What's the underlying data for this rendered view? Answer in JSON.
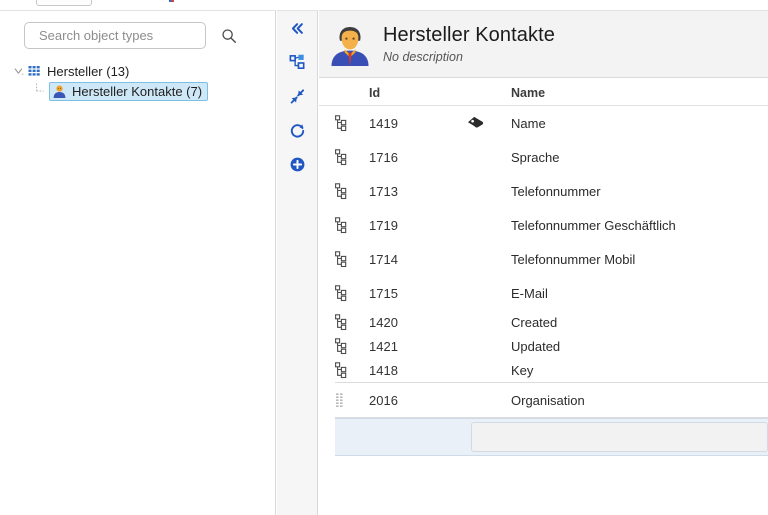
{
  "sidebar": {
    "search": {
      "placeholder": "Search object types",
      "value": "",
      "icon": "search-icon"
    },
    "tree": [
      {
        "label": "Hersteller (13)",
        "icon": "grid-table-icon",
        "level": 0,
        "selected": false,
        "expanded": true
      },
      {
        "label": "Hersteller Kontakte (7)",
        "icon": "person-icon",
        "level": 1,
        "selected": true,
        "expanded": false
      }
    ]
  },
  "toolbar": {
    "buttons": [
      {
        "name": "collapse-panel-button",
        "icon": "double-chevron-left-icon",
        "label": "«"
      },
      {
        "name": "hierarchy-view-button",
        "icon": "hierarchy-icon",
        "label": ""
      },
      {
        "name": "collapse-all-button",
        "icon": "collapse-arrows-icon",
        "label": ""
      },
      {
        "name": "refresh-button",
        "icon": "refresh-icon",
        "label": ""
      },
      {
        "name": "add-button",
        "icon": "plus-circle-icon",
        "label": ""
      }
    ]
  },
  "main": {
    "header": {
      "icon": "person-avatar-icon",
      "title": "Hersteller Kontakte",
      "description": "No description"
    },
    "table": {
      "columns": [
        {
          "key": "icon",
          "label": ""
        },
        {
          "key": "id",
          "label": "Id"
        },
        {
          "key": "tag",
          "label": ""
        },
        {
          "key": "name",
          "label": "Name"
        }
      ],
      "rows": [
        {
          "icon": "attribute-hierarchy-icon",
          "id": "1419",
          "tag": "tag-icon",
          "name": "Name"
        },
        {
          "icon": "attribute-hierarchy-icon",
          "id": "1716",
          "tag": "",
          "name": "Sprache"
        },
        {
          "icon": "attribute-hierarchy-icon",
          "id": "1713",
          "tag": "",
          "name": "Telefonnummer"
        },
        {
          "icon": "attribute-hierarchy-icon",
          "id": "1719",
          "tag": "",
          "name": "Telefonnummer Geschäftlich"
        },
        {
          "icon": "attribute-hierarchy-icon",
          "id": "1714",
          "tag": "",
          "name": "Telefonnummer Mobil"
        },
        {
          "icon": "attribute-hierarchy-icon",
          "id": "1715",
          "tag": "",
          "name": "E-Mail"
        },
        {
          "icon": "attribute-hierarchy-icon",
          "id": "1420",
          "tag": "",
          "name": "Created"
        },
        {
          "icon": "attribute-hierarchy-icon",
          "id": "1421",
          "tag": "",
          "name": "Updated"
        },
        {
          "icon": "attribute-hierarchy-icon",
          "id": "1418",
          "tag": "",
          "name": "Key"
        }
      ],
      "inherited_rows": [
        {
          "icon": "dotted-grid-icon",
          "id": "2016",
          "tag": "",
          "name": "Organisation"
        }
      ],
      "new_row": {
        "input_value": "",
        "input_placeholder": ""
      }
    }
  },
  "colors": {
    "accent": "#1f6fd0",
    "selection_bg": "#cfe8f7",
    "selection_border": "#7cc0e4",
    "header_bg": "#f3f3f3",
    "toolbar_bg": "#f6f6f6",
    "new_row_bg": "#e9f0f8"
  }
}
